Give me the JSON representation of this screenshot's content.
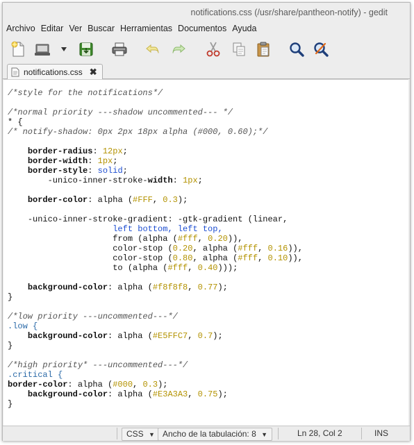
{
  "window": {
    "title": "notifications.css (/usr/share/pantheon-notify) - gedit"
  },
  "menubar": {
    "items": [
      "Archivo",
      "Editar",
      "Ver",
      "Buscar",
      "Herramientas",
      "Documentos",
      "Ayuda"
    ]
  },
  "toolbar": {
    "buttons": [
      {
        "name": "new-document-icon"
      },
      {
        "name": "open-icon"
      },
      {
        "name": "open-recent-arrow-icon"
      },
      {
        "name": "save-icon"
      },
      {
        "name": "print-icon"
      },
      {
        "name": "undo-icon"
      },
      {
        "name": "redo-icon"
      },
      {
        "name": "cut-icon"
      },
      {
        "name": "copy-icon"
      },
      {
        "name": "paste-icon"
      },
      {
        "name": "find-icon"
      },
      {
        "name": "find-replace-icon"
      }
    ]
  },
  "tab": {
    "title": "notifications.css",
    "close_glyph": "✖"
  },
  "editor": {
    "lines": [
      "/*style for the notifications*/",
      "",
      "/*normal priority ---shadow uncommented--- */",
      "* {",
      "   /* notify-shadow: 0px 2px 18px alpha (#000, 0.60);*/",
      "",
      "    border-radius: 12px;",
      "    border-width: 1px;",
      "    border-style: solid;",
      "        -unico-inner-stroke-width: 1px;",
      "",
      "    border-color: alpha (#FFF, 0.3);",
      "",
      "    -unico-inner-stroke-gradient: -gtk-gradient (linear,",
      "                     left bottom, left top,",
      "                     from (alpha (#fff, 0.20)),",
      "                     color-stop (0.20, alpha (#fff, 0.16)),",
      "                     color-stop (0.80, alpha (#fff, 0.10)),",
      "                     to (alpha (#fff, 0.40)));",
      "",
      "    background-color: alpha (#f8f8f8, 0.77);",
      "}",
      "",
      "/*low priority ---uncommented---*/",
      ".low {",
      "    background-color: alpha (#E5FFC7, 0.7);",
      "}",
      "",
      "/*high priority* ---uncommented---*/",
      ".critical {",
      "border-color: alpha (#000, 0.3);",
      "    background-color: alpha (#E3A3A3, 0.75);",
      "}"
    ]
  },
  "statusbar": {
    "language": "CSS",
    "tab_width": "Ancho de la tabulación:  8",
    "dropdown_glyph": "▼",
    "position": "Ln 28, Col 2",
    "mode": "INS"
  }
}
